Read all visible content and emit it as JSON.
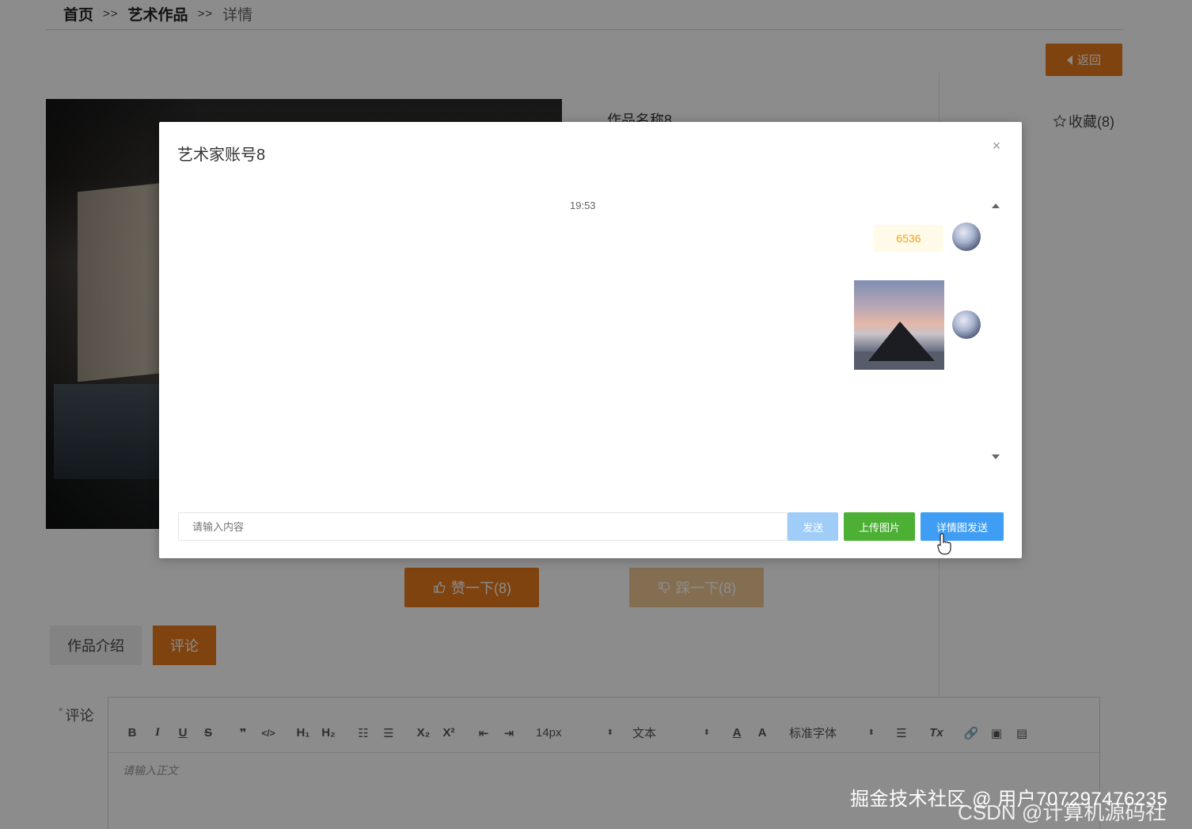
{
  "breadcrumb": {
    "home": "首页",
    "sep1": ">>",
    "category": "艺术作品",
    "sep2": ">>",
    "current": "详情"
  },
  "header": {
    "back_label": "返回"
  },
  "artwork": {
    "name_label": "作品名称8",
    "collect_label": "收藏(8)",
    "like_label": "赞一下(8)",
    "dislike_label": "踩一下(8)"
  },
  "tabs": [
    {
      "label": "作品介绍",
      "active": false
    },
    {
      "label": "评论",
      "active": true
    }
  ],
  "comment_form": {
    "label": "评论",
    "required_mark": "*",
    "editor_placeholder": "请输入正文",
    "toolbar": {
      "bold": "B",
      "italic": "I",
      "underline": "U",
      "strike": "S",
      "quote": "❞",
      "code": "</>",
      "h1": "H₁",
      "h2": "H₂",
      "ordered_list": "☷",
      "bullet_list": "☰",
      "subscript": "X₂",
      "superscript": "X²",
      "outdent": "⇤",
      "indent": "⇥",
      "font_size": "14px",
      "text_type": "文本",
      "font_color": "A",
      "bg_color": "A",
      "font_family": "标准字体",
      "align": "☰",
      "clear_format": "Tx",
      "link": "🔗",
      "image": "▣",
      "video": "▤"
    }
  },
  "chat_modal": {
    "title": "艺术家账号8",
    "close_icon": "×",
    "time": "19:53",
    "messages": [
      {
        "type": "text",
        "content": "6536"
      },
      {
        "type": "image"
      }
    ],
    "input_placeholder": "请输入内容",
    "send_label": "发送",
    "upload_label": "上传图片",
    "detail_send_label": "详情图发送"
  },
  "watermark": {
    "line1": "掘金技术社区 @ 用户707297476235",
    "line2": "CSDN @计算机源码社"
  },
  "colors": {
    "accent": "#e77b1c",
    "send_disabled": "#9fcdf7",
    "upload_green": "#4cb034",
    "primary_blue": "#3f9ef3",
    "message_text": "#f0a21f"
  }
}
